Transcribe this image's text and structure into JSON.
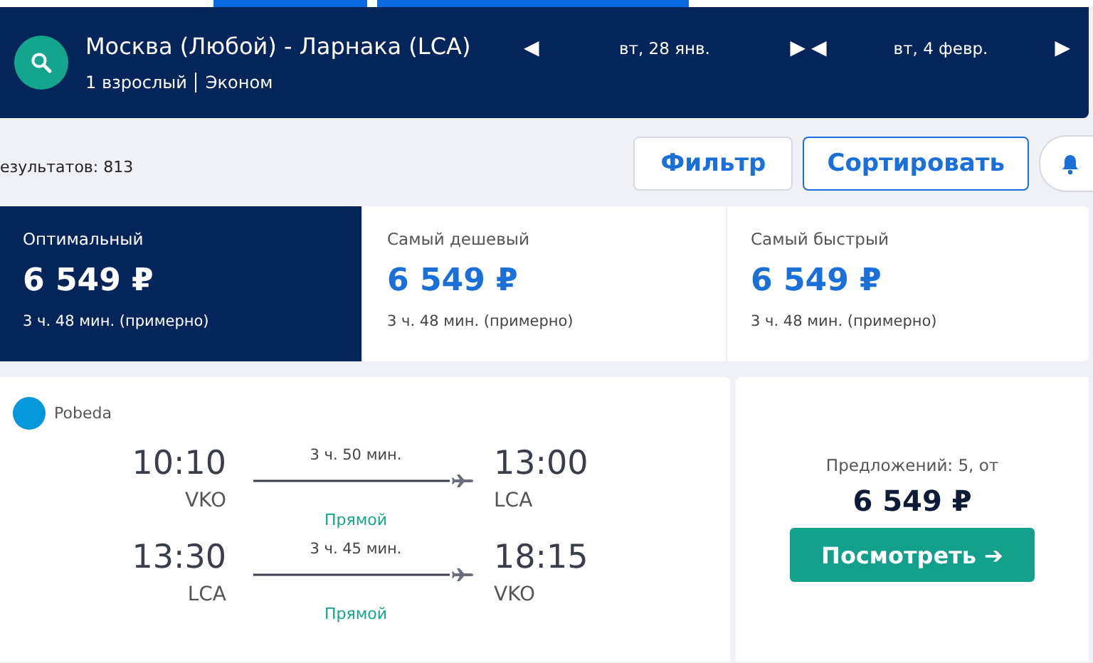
{
  "search_bar": {
    "route": "Москва (Любой) - Ларнака (LCA)",
    "passengers": "1 взрослый",
    "cabin": "Эконом",
    "dates": [
      {
        "label": "вт, 28 янв.",
        "prev": "◀",
        "next": "▶"
      },
      {
        "label": "вт, 4 февр.",
        "prev": "◀",
        "next": "▶"
      }
    ]
  },
  "results_count": "езультатов: 813",
  "buttons": [
    {
      "label": "Фильтр",
      "selected": false
    },
    {
      "label": "Сортировать",
      "selected": true
    }
  ],
  "sort_tabs": [
    {
      "title": "Оптимальный",
      "price": "6 549 ₽",
      "duration": "3 ч. 48 мин. (примерно)",
      "selected": true
    },
    {
      "title": "Самый дешевый",
      "price": "6 549 ₽",
      "duration": "3 ч. 48 мин. (примерно)",
      "selected": false
    },
    {
      "title": "Самый быстрый",
      "price": "6 549 ₽",
      "duration": "3 ч. 48 мин. (примерно)",
      "selected": false
    }
  ],
  "flight": {
    "airline": "Pobeda",
    "legs": [
      {
        "depart_time": "10:10",
        "depart_airport": "VKO",
        "duration": "3 ч. 50 мин.",
        "stops": "Прямой",
        "arrive_time": "13:00",
        "arrive_airport": "LCA"
      },
      {
        "depart_time": "13:30",
        "depart_airport": "LCA",
        "duration": "3 ч. 45 мин.",
        "stops": "Прямой",
        "arrive_time": "18:15",
        "arrive_airport": "VKO"
      }
    ],
    "offers": "Предложений: 5, от",
    "price": "6 549 ₽",
    "action": "Посмотреть ➔"
  }
}
